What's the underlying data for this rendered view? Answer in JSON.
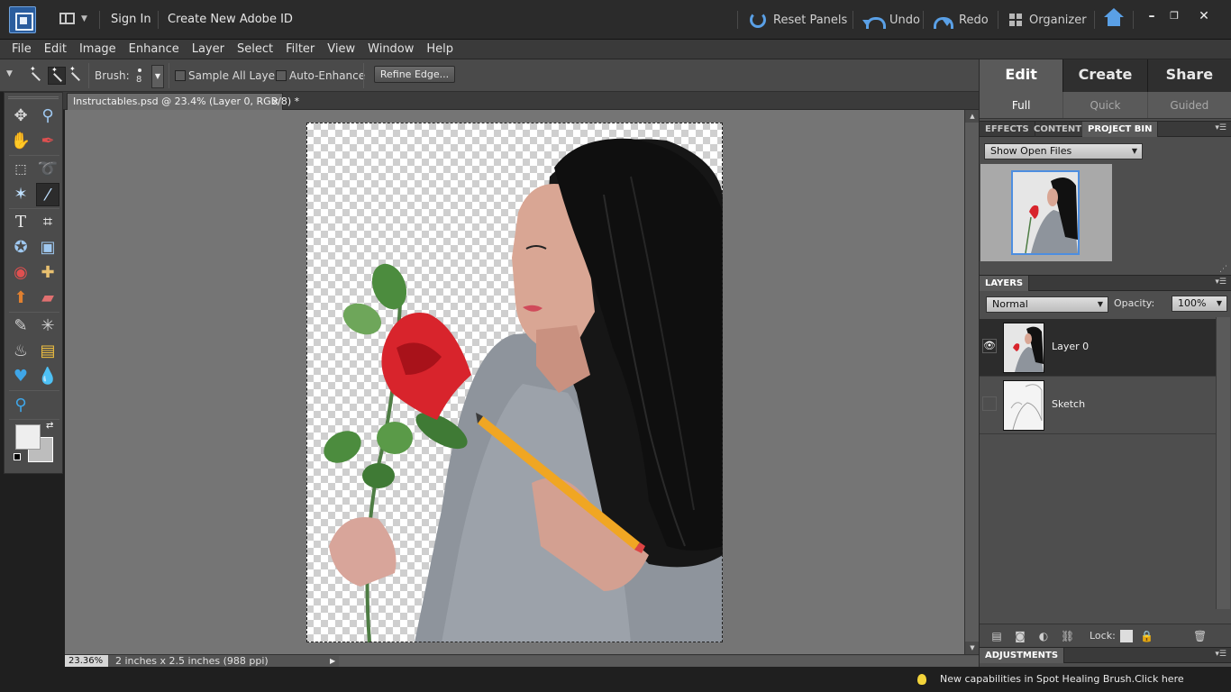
{
  "titlebar": {
    "sign_in": "Sign In",
    "create_id": "Create New Adobe ID",
    "reset_panels": "Reset Panels",
    "undo": "Undo",
    "redo": "Redo",
    "organizer": "Organizer",
    "minimize": "–",
    "maximize": "❐",
    "close": "✕"
  },
  "menu": [
    "File",
    "Edit",
    "Image",
    "Enhance",
    "Layer",
    "Select",
    "Filter",
    "View",
    "Window",
    "Help"
  ],
  "options": {
    "brush_label": "Brush:",
    "brush_size": "8",
    "sample_all_layers": "Sample All Layers",
    "sample_all_checked": false,
    "auto_enhance": "Auto-Enhance",
    "auto_enhance_checked": false,
    "refine_edge": "Refine Edge..."
  },
  "document": {
    "tab_title": "Instructables.psd @ 23.4% (Layer 0, RGB/8) *",
    "tab_close": "×",
    "zoom": "23.36%",
    "doc_size": "2 inches x 2.5 inches (988 ppi)"
  },
  "modes": {
    "tabs": [
      "Edit",
      "Create",
      "Share"
    ],
    "active_tab": "Edit",
    "subtabs": [
      "Full",
      "Quick",
      "Guided"
    ],
    "active_subtab": "Full"
  },
  "bin_panel": {
    "tabs": [
      "EFFECTS",
      "CONTENT",
      "PROJECT BIN"
    ],
    "active": "PROJECT BIN",
    "show_dropdown": "Show Open Files"
  },
  "layers_panel": {
    "title": "LAYERS",
    "blend_mode": "Normal",
    "opacity_label": "Opacity:",
    "opacity": "100%",
    "lock_label": "Lock:",
    "layers": [
      {
        "name": "Layer 0",
        "visible": true,
        "active": true
      },
      {
        "name": "Sketch",
        "visible": false,
        "active": false
      }
    ]
  },
  "adjustments_title": "ADJUSTMENTS",
  "status_tip": "New capabilities in Spot Healing Brush.Click here",
  "colors": {
    "accent_blue": "#5aa0e6",
    "foreground": "#eeeeee",
    "background": "#bdbdbd"
  }
}
